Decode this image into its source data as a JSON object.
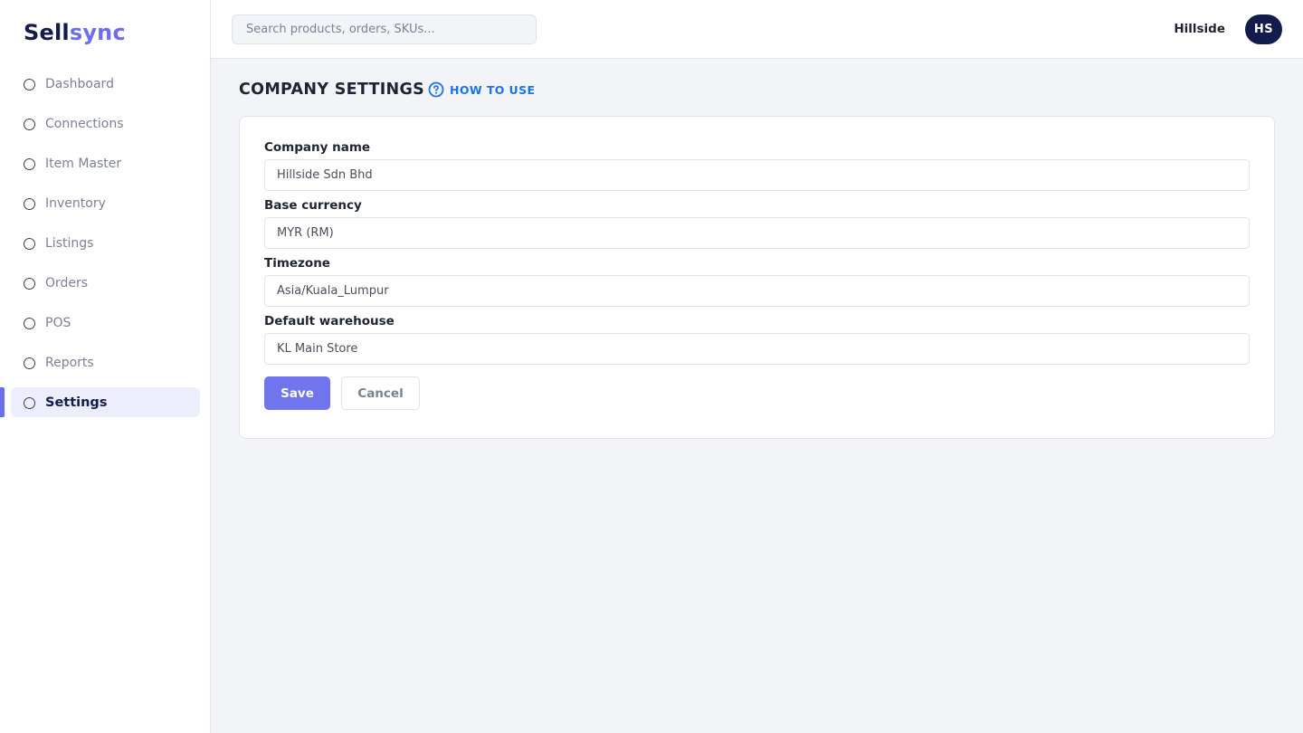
{
  "brand": {
    "part1": "Sell",
    "part2": "sync",
    "color_dark": "#141b4d",
    "color_accent": "#6b6fe8"
  },
  "search": {
    "placeholder": "Search products, orders, SKUs..."
  },
  "user": {
    "name": "Hillside",
    "initials": "HS"
  },
  "sidebar": {
    "items": [
      {
        "label": "Dashboard",
        "icon": "circle-icon",
        "active": false
      },
      {
        "label": "Connections",
        "icon": "circle-icon",
        "active": false
      },
      {
        "label": "Item Master",
        "icon": "circle-icon",
        "active": false
      },
      {
        "label": "Inventory",
        "icon": "circle-icon",
        "active": false
      },
      {
        "label": "Listings",
        "icon": "circle-icon",
        "active": false
      },
      {
        "label": "Orders",
        "icon": "circle-icon",
        "active": false
      },
      {
        "label": "POS",
        "icon": "circle-icon",
        "active": false
      },
      {
        "label": "Reports",
        "icon": "circle-icon",
        "active": false
      },
      {
        "label": "Settings",
        "icon": "circle-icon",
        "active": true
      }
    ]
  },
  "page": {
    "title": "COMPANY SETTINGS",
    "help_link": "HOW TO USE",
    "help_icon": "help-circle-icon"
  },
  "form": {
    "fields": [
      {
        "label": "Company name",
        "value": "Hillside Sdn Bhd"
      },
      {
        "label": "Base currency",
        "value": "MYR (RM)"
      },
      {
        "label": "Timezone",
        "value": "Asia/Kuala_Lumpur"
      },
      {
        "label": "Default warehouse",
        "value": "KL Main Store"
      }
    ],
    "save_label": "Save",
    "cancel_label": "Cancel"
  }
}
